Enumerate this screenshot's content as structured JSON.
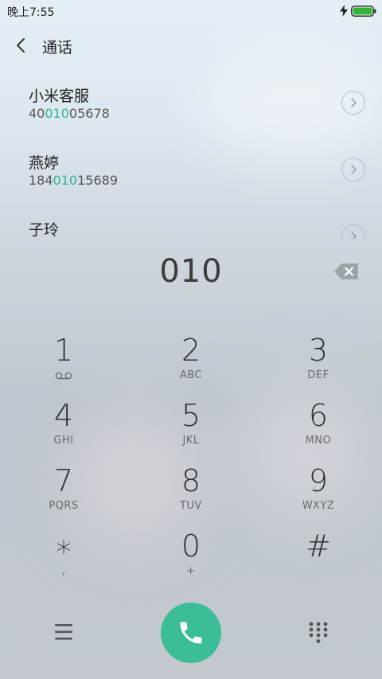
{
  "status_bar": {
    "time": "晚上7:55",
    "battery_color": "#2fb532"
  },
  "header": {
    "title": "通话"
  },
  "contacts": [
    {
      "name": "小米客服",
      "number_prefix": "40",
      "number_match": "010",
      "number_suffix": "05678"
    },
    {
      "name": "燕婷",
      "number_prefix": "184",
      "number_match": "010",
      "number_suffix": "15689"
    },
    {
      "name": "子玲",
      "number_prefix": "",
      "number_match": "",
      "number_suffix": ""
    }
  ],
  "dialer": {
    "dialed_number": "010"
  },
  "keypad": {
    "keys": [
      {
        "digit": "1",
        "letters": ""
      },
      {
        "digit": "2",
        "letters": "ABC"
      },
      {
        "digit": "3",
        "letters": "DEF"
      },
      {
        "digit": "4",
        "letters": "GHI"
      },
      {
        "digit": "5",
        "letters": "JKL"
      },
      {
        "digit": "6",
        "letters": "MNO"
      },
      {
        "digit": "7",
        "letters": "PQRS"
      },
      {
        "digit": "8",
        "letters": "TUV"
      },
      {
        "digit": "9",
        "letters": "WXYZ"
      },
      {
        "digit": "∗",
        "letters": ","
      },
      {
        "digit": "0",
        "letters": "+"
      },
      {
        "digit": "#",
        "letters": ""
      }
    ]
  },
  "colors": {
    "accent": "#2fb592",
    "call_button": "#3bbd98"
  }
}
